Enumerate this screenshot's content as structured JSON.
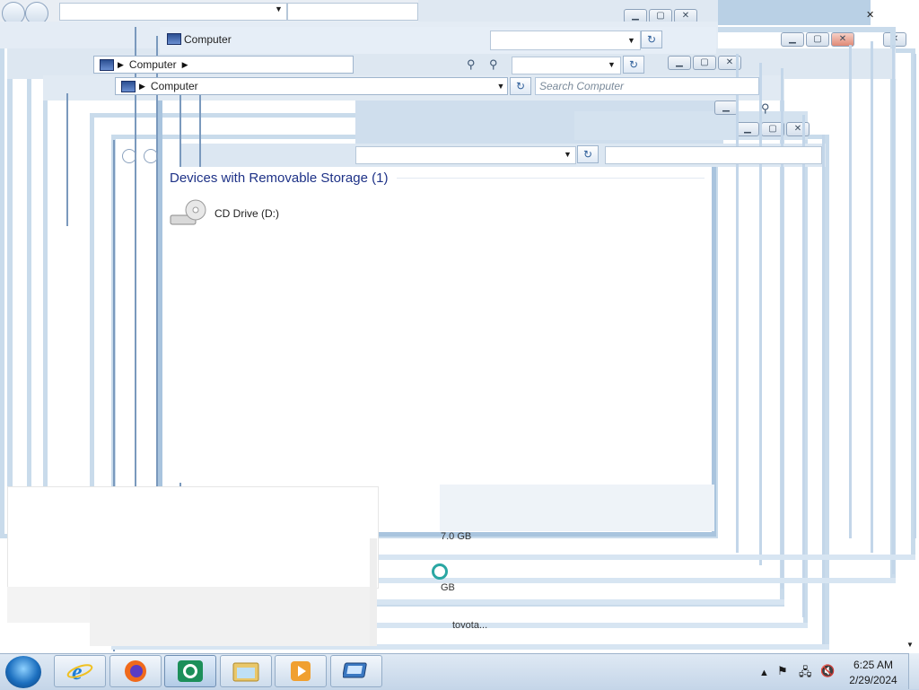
{
  "windows": {
    "front_title": "Computer",
    "breadcrumb_root": "Computer",
    "search_placeholder": "Search Computer",
    "group_header": "Devices with Removable Storage (1)",
    "drive_label": "CD Drive (D:)"
  },
  "fragments": {
    "size_fragment": "7.0 GB",
    "gb_fragment": "GB",
    "name_fragment": "toyota..."
  },
  "taskbar": {
    "apps": [
      {
        "name": "Internet Explorer"
      },
      {
        "name": "Firefox"
      },
      {
        "name": "Media App"
      },
      {
        "name": "Windows Explorer"
      },
      {
        "name": "Media Player"
      },
      {
        "name": "Remote Desktop"
      }
    ],
    "time": "6:25 AM",
    "date": "2/29/2024"
  },
  "colors": {
    "frame": "#c9dbeb",
    "taskbar": "#c4d5e8",
    "header_text": "#1e3287"
  }
}
